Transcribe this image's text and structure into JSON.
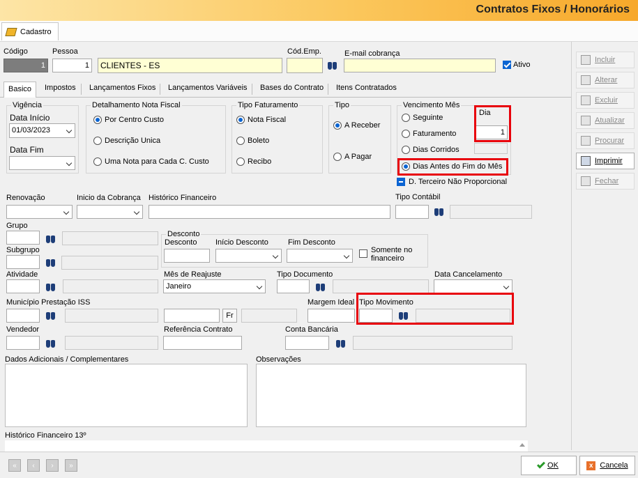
{
  "window": {
    "title": "Contratos Fixos / Honorários"
  },
  "top_tab": {
    "label": "Cadastro"
  },
  "header": {
    "codigo_label": "Código",
    "codigo_value": "1",
    "pessoa_label": "Pessoa",
    "pessoa_value": "1",
    "pessoa_nome": "CLIENTES - ES",
    "cod_emp_label": "Cód.Emp.",
    "cod_emp_value": "",
    "email_label": "E-mail cobrança",
    "email_value": "",
    "ativo_label": "Ativo"
  },
  "tabs": [
    "Basico",
    "Impostos",
    "Lançamentos Fixos",
    "Lançamentos Variáveis",
    "Bases do Contrato",
    "Itens Contratados"
  ],
  "vigencia": {
    "caption": "Vigência",
    "data_inicio_label": "Data Início",
    "data_inicio_value": "01/03/2023",
    "data_fim_label": "Data Fim",
    "data_fim_value": ""
  },
  "detalhamento": {
    "caption": "Detalhamento Nota Fiscal",
    "options": [
      "Por Centro Custo",
      "Descrição Unica",
      "Uma Nota para Cada C. Custo"
    ]
  },
  "tipo_faturamento": {
    "caption": "Tipo Faturamento",
    "options": [
      "Nota Fiscal",
      "Boleto",
      "Recibo"
    ]
  },
  "tipo": {
    "caption": "Tipo",
    "options": [
      "A Receber",
      "A Pagar"
    ]
  },
  "vencimento": {
    "caption": "Vencimento Mês",
    "options": [
      "Seguinte",
      "Faturamento",
      "Dias Corridos",
      "Dias Antes do Fim do Mês"
    ],
    "dia_label": "Dia",
    "dia_value": "1",
    "terceiro_label": "D. Terceiro Não Proporcional"
  },
  "row1": {
    "renovacao_label": "Renovação",
    "renovacao_value": "",
    "inicio_cobranca_label": "Inicio da Cobrança",
    "inicio_cobranca_value": "",
    "historico_label": "Histórico Financeiro",
    "historico_value": "",
    "tipo_contabil_label": "Tipo Contábil",
    "tipo_contabil_value": ""
  },
  "grupo": {
    "label": "Grupo",
    "subgrupo_label": "Subgrupo"
  },
  "desconto": {
    "caption": "Desconto",
    "desconto_label": "Desconto",
    "inicio_label": "Início Desconto",
    "fim_label": "Fim Desconto",
    "somente_label": "Somente no financeiro"
  },
  "row3": {
    "atividade_label": "Atividade",
    "mes_reajuste_label": "Mês de Reajuste",
    "mes_reajuste_value": "Janeiro",
    "tipo_documento_label": "Tipo Documento",
    "data_cancelamento_label": "Data Cancelamento"
  },
  "row4": {
    "municipio_label": "Município Prestação ISS",
    "fr_label": "Fr",
    "margem_label": "Margem Ideal",
    "tipo_movimento_label": "Tipo Movimento"
  },
  "row5": {
    "vendedor_label": "Vendedor",
    "referencia_label": "Referência Contrato",
    "conta_label": "Conta Bancária"
  },
  "notes": {
    "dados_label": "Dados Adicionais / Complementares",
    "observacoes_label": "Observações",
    "historico13_label": "Histórico Financeiro 13º"
  },
  "side_buttons": [
    "Incluir",
    "Alterar",
    "Excluir",
    "Atualizar",
    "Procurar",
    "Imprimir",
    "Fechar"
  ],
  "bottom": {
    "ok_label": "OK",
    "cancel_label": "Cancela"
  },
  "colors": {
    "accent": "#0a64d2",
    "highlight": "#e8000b",
    "title_gradient_end": "#f7a82a"
  }
}
